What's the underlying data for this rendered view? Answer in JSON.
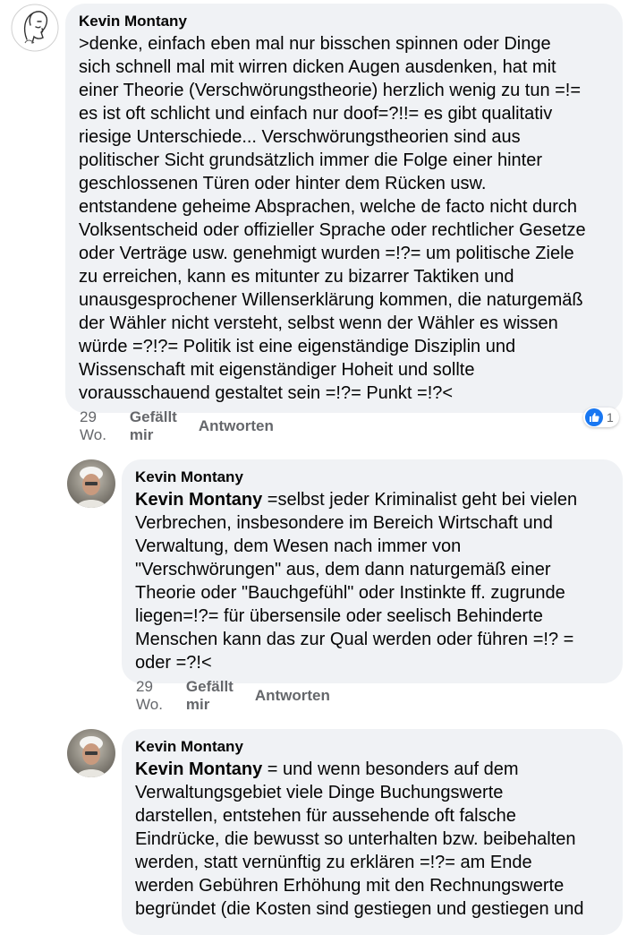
{
  "comments": [
    {
      "author": "Kevin Montany",
      "mention": "",
      "text": ">denke, einfach eben mal  nur bisschen spinnen oder Dinge\nsich schnell mal mit wirren dicken Augen ausdenken, hat mit\neiner Theorie (Verschwörungstheorie) herzlich wenig zu tun =!=\nes ist oft schlicht und einfach nur doof=?!!= es gibt qualitativ\nriesige Unterschiede... Verschwörungstheorien sind  aus\npolitischer Sicht grundsätzlich immer die Folge einer hinter\ngeschlossenen Türen oder hinter dem Rücken usw.\nentstandene geheime Absprachen, welche de facto nicht  durch\nVolksentscheid oder offizieller Sprache oder rechtlicher Gesetze\noder Verträge usw. genehmigt wurden =!?= um politische Ziele\nzu erreichen, kann es mitunter zu bizarrer Taktiken und\nunausgesprochener Willenserklärung kommen, die naturgemäß\nder Wähler nicht versteht, selbst wenn der Wähler es wissen\nwürde =?!?= Politik ist eine eigenständige Disziplin und\nWissenschaft mit eigenständiger Hoheit und sollte\nvorausschauend gestaltet sein =!?=  Punkt =!?<",
      "time": "29 Wo.",
      "like_label": "Gefällt mir",
      "reply_label": "Antworten",
      "reaction_count": "1",
      "avatar_icon": "sketch-face-avatar"
    },
    {
      "author": "Kevin Montany",
      "mention": "Kevin Montany",
      "text": " =selbst jeder Kriminalist geht bei vielen\nVerbrechen, insbesondere im Bereich Wirtschaft und\nVerwaltung, dem Wesen nach immer von\n\"Verschwörungen\" aus, dem dann naturgemäß einer\nTheorie oder  \"Bauchgefühl\" oder Instinkte ff. zugrunde\nliegen=!?= für übersensile oder seelisch Behinderte\nMenschen kann das zur Qual werden oder führen =!? =\noder =?!<",
      "time": "29 Wo.",
      "like_label": "Gefällt mir",
      "reply_label": "Antworten",
      "avatar_icon": "photo-avatar"
    },
    {
      "author": "Kevin Montany",
      "mention": "Kevin Montany",
      "text": " = und wenn besonders auf dem\nVerwaltungsgebiet viele Dinge Buchungswerte\ndarstellen, entstehen für aussehende oft falsche\nEindrücke, die bewusst so unterhalten bzw. beibehalten\nwerden, statt vernünftig zu erklären =!?= am Ende\nwerden  Gebühren Erhöhung mit den Rechnungswerte\nbegründet (die Kosten sind gestiegen und gestiegen und",
      "avatar_icon": "photo-avatar"
    }
  ],
  "colors": {
    "bubble": "#f0f2f5",
    "meta_text": "#65676b",
    "like_blue": "#1877f2"
  }
}
